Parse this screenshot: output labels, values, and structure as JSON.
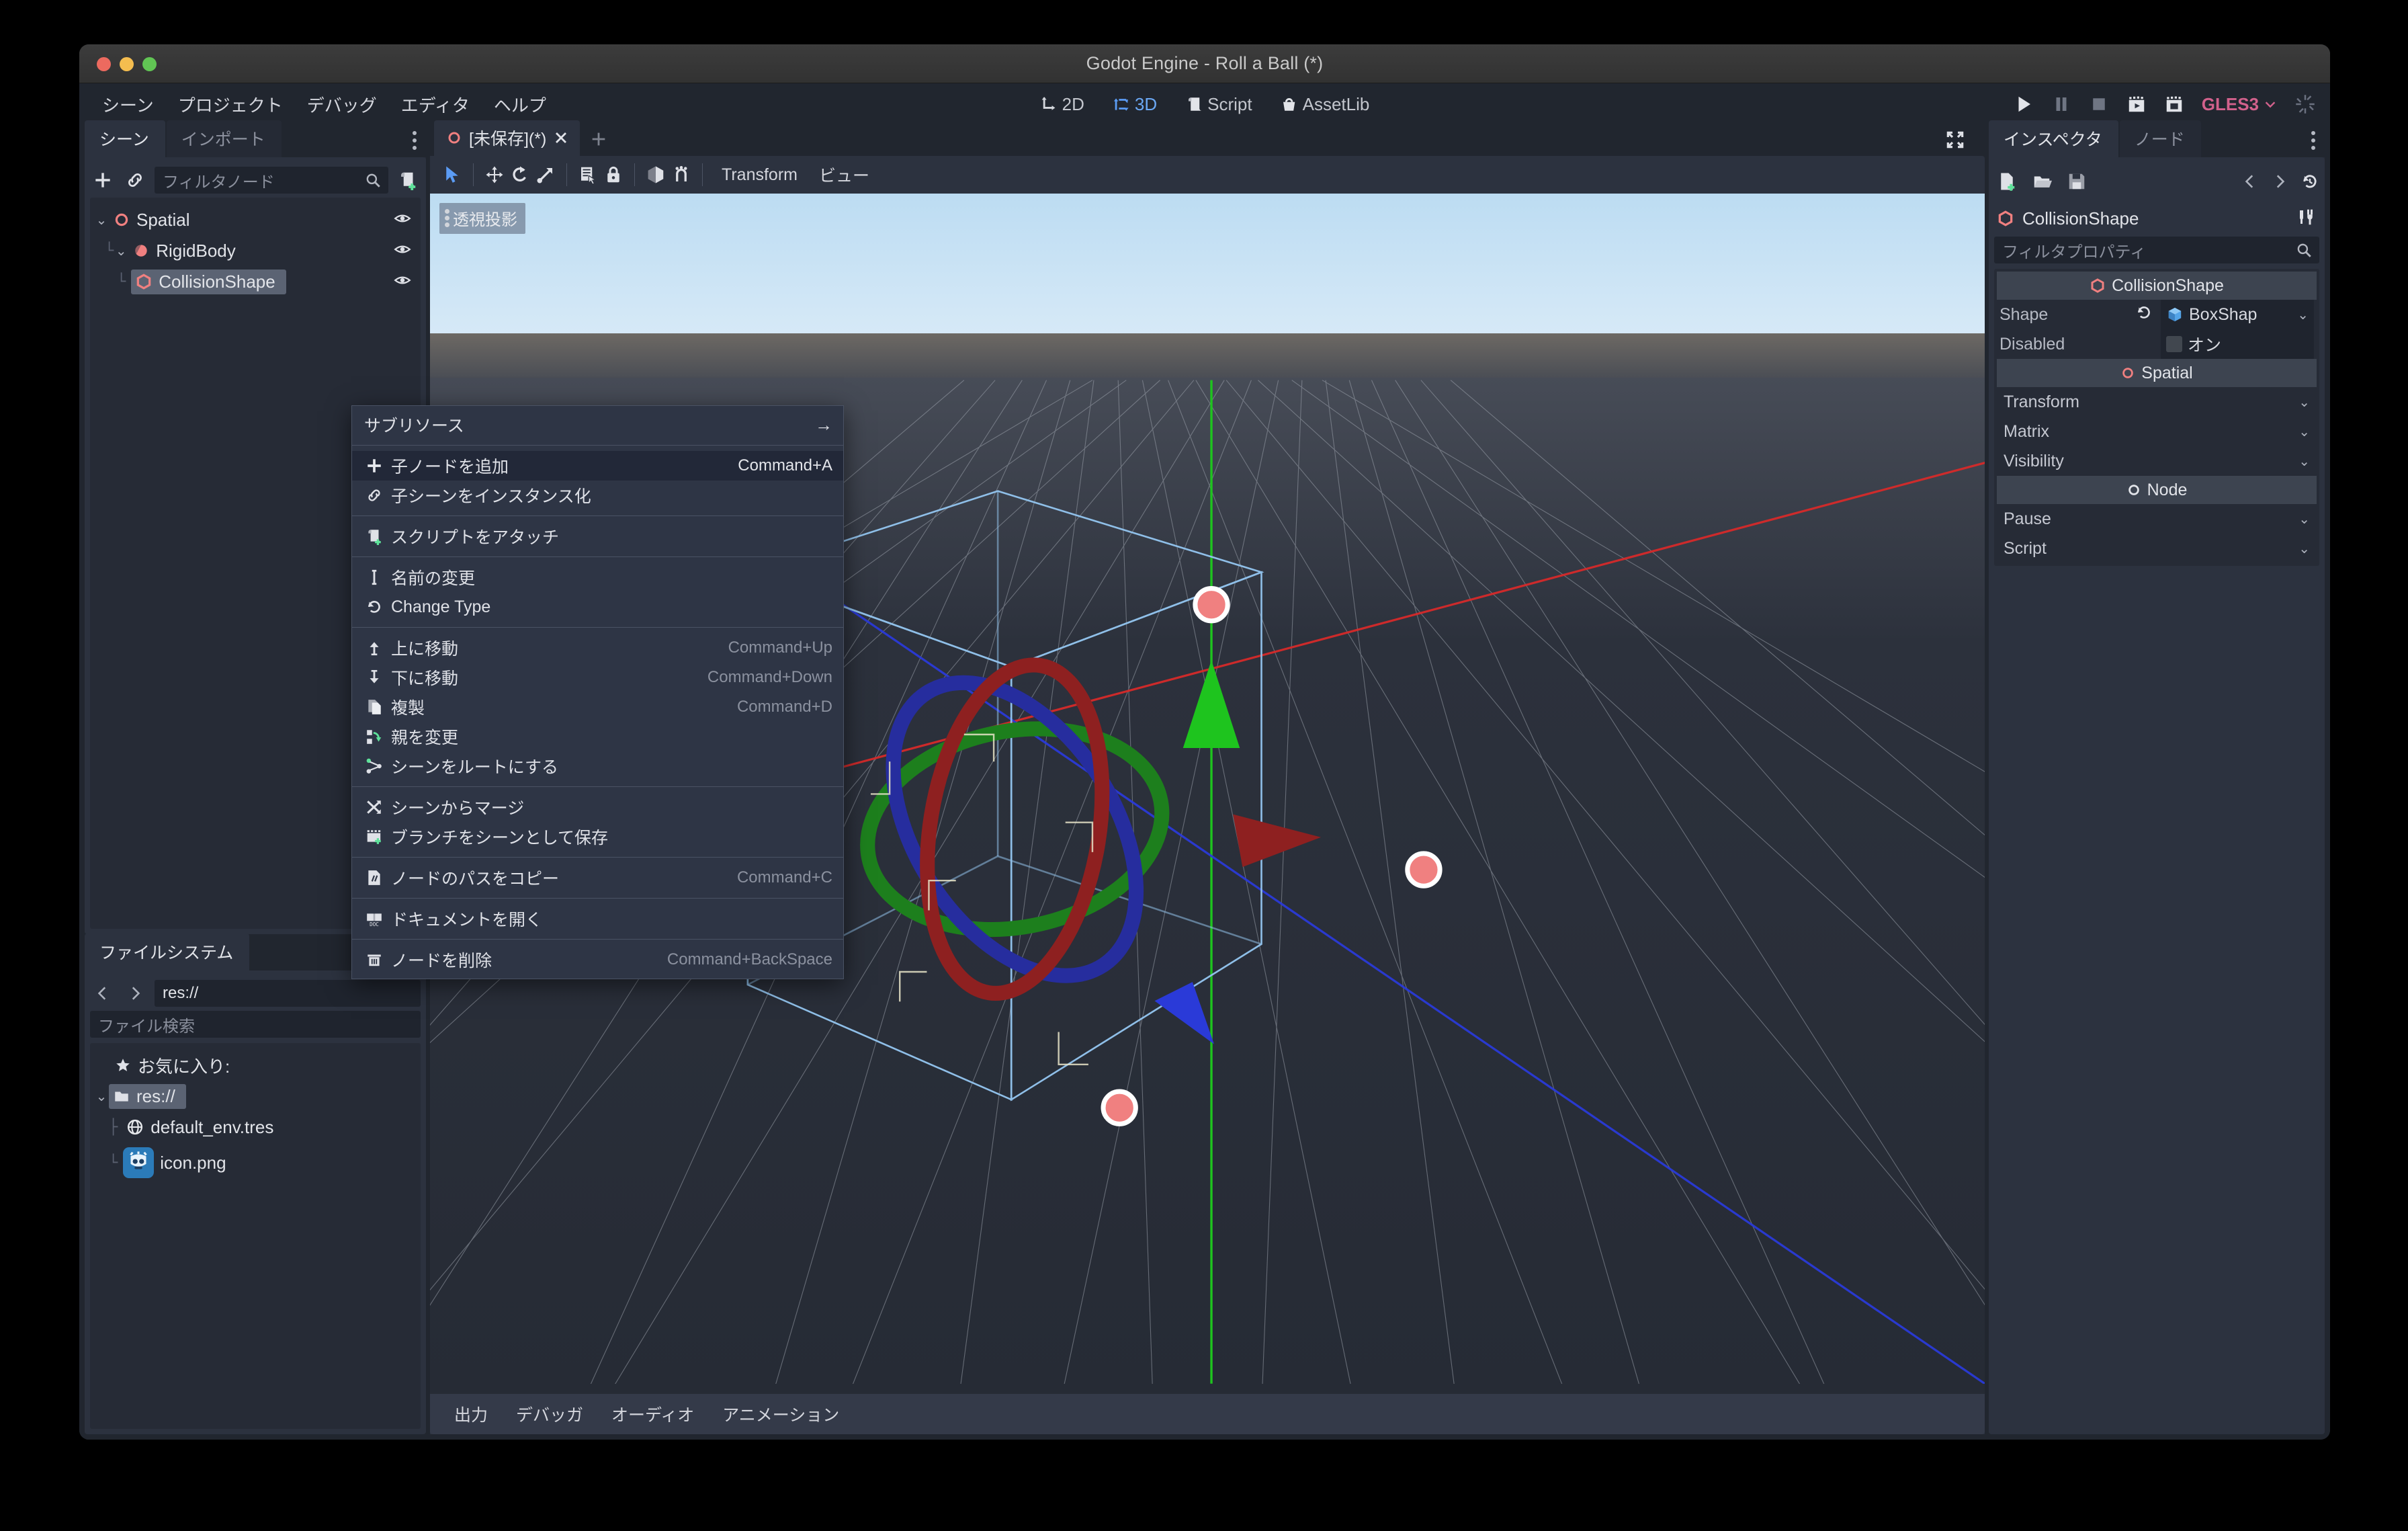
{
  "window": {
    "title": "Godot Engine - Roll a Ball (*)"
  },
  "menubar": {
    "items": [
      "シーン",
      "プロジェクト",
      "デバッグ",
      "エディタ",
      "ヘルプ"
    ]
  },
  "center_tools": {
    "modes": [
      {
        "label": "2D",
        "icon": "2d-icon",
        "active": false
      },
      {
        "label": "3D",
        "icon": "3d-icon",
        "active": true
      },
      {
        "label": "Script",
        "icon": "script-icon",
        "active": false
      },
      {
        "label": "AssetLib",
        "icon": "assetlib-icon",
        "active": false
      }
    ]
  },
  "right_tools": {
    "play": "play-icon",
    "pause": "pause-icon",
    "stop": "stop-icon",
    "play_scene": "play-scene-icon",
    "play_custom": "play-custom-scene-icon",
    "renderer": "GLES3",
    "busy": "progress-spinner-icon"
  },
  "scene_dock": {
    "tabs": [
      {
        "label": "シーン",
        "active": true
      },
      {
        "label": "インポート",
        "active": false
      }
    ],
    "toolbar": {
      "add_node": "plus-icon",
      "instance_scene": "link-icon",
      "filter_placeholder": "フィルタノード",
      "search_icon": "search-icon",
      "attach_script": "attach-script-icon"
    },
    "tree": [
      {
        "label": "Spatial",
        "icon": "spatial-node-icon",
        "depth": 0,
        "selected": false,
        "visible_icon": "eye-icon"
      },
      {
        "label": "RigidBody",
        "icon": "rigidbody-node-icon",
        "depth": 1,
        "selected": false,
        "visible_icon": "eye-icon"
      },
      {
        "label": "CollisionShape",
        "icon": "collisionshape-node-icon",
        "depth": 2,
        "selected": true,
        "visible_icon": "eye-icon"
      }
    ]
  },
  "filesystem_dock": {
    "tabs": [
      {
        "label": "ファイルシステム",
        "active": true
      }
    ],
    "path_value": "res://",
    "back_icon": "chevron-left-icon",
    "forward_icon": "chevron-right-icon",
    "search_placeholder": "ファイル検索",
    "tree": [
      {
        "label": "お気に入り:",
        "icon": "star-icon",
        "depth": 0,
        "selected": false
      },
      {
        "label": "res://",
        "icon": "folder-icon",
        "depth": 0,
        "selected": true
      },
      {
        "label": "default_env.tres",
        "icon": "world-environment-icon",
        "depth": 1,
        "selected": false
      },
      {
        "label": "icon.png",
        "icon": "godot-icon",
        "depth": 1,
        "selected": false
      }
    ]
  },
  "scene_tabs": {
    "tabs": [
      {
        "label": "[未保存](*)",
        "icon": "spatial-node-icon",
        "close_icon": "close-icon",
        "active": true
      }
    ],
    "new_tab_icon": "plus-icon",
    "expand_icon": "expand-icon"
  },
  "viewport_toolbar": {
    "tools": [
      {
        "name": "select-mode-icon",
        "active": true
      },
      {
        "name": "move-mode-icon",
        "active": false
      },
      {
        "name": "rotate-mode-icon",
        "active": false
      },
      {
        "name": "scale-mode-icon",
        "active": false
      },
      {
        "name": "list-select-icon",
        "active": false
      },
      {
        "name": "lock-icon",
        "active": false
      },
      {
        "name": "local-space-icon",
        "active": false
      },
      {
        "name": "snap-icon",
        "active": false
      }
    ],
    "menus": [
      "Transform",
      "ビュー"
    ]
  },
  "viewport": {
    "projection_label": "透視投影",
    "projection_menu_icon": "dots-vertical-icon",
    "sky_color": "#c7e2f4",
    "ground_color": "#2c313c",
    "gizmo": {
      "x_axis_color": "#e0282c",
      "y_axis_color": "#22c422",
      "z_axis_color": "#2230dd",
      "handle_color": "#f08080",
      "box_wire_color": "#8fbfe8"
    }
  },
  "bottom_panel": {
    "tabs": [
      "出力",
      "デバッガ",
      "オーディオ",
      "アニメーション"
    ]
  },
  "inspector": {
    "tabs": [
      {
        "label": "インスペクタ",
        "active": true
      },
      {
        "label": "ノード",
        "active": false
      }
    ],
    "toolbar": {
      "new_resource": "new-resource-icon",
      "load": "folder-open-icon",
      "save": "save-icon",
      "back": "chevron-left-icon",
      "forward": "chevron-right-icon",
      "history": "history-icon"
    },
    "object_name": "CollisionShape",
    "object_icon": "collisionshape-node-icon",
    "tools_icon": "object-tools-icon",
    "filter_placeholder": "フィルタプロパティ",
    "filter_search_icon": "search-icon",
    "sections": [
      {
        "type": "category",
        "label": "CollisionShape",
        "icon": "collisionshape-node-icon"
      },
      {
        "type": "property",
        "label": "Shape",
        "revert_icon": "revert-icon",
        "value": "BoxShap",
        "value_icon": "boxshape-icon",
        "caret": "chevron-down-icon"
      },
      {
        "type": "property_check",
        "label": "Disabled",
        "value": "オン",
        "checked": false
      },
      {
        "type": "category",
        "label": "Spatial",
        "icon": "spatial-node-icon"
      },
      {
        "type": "fold",
        "label": "Transform",
        "caret": "chevron-down-icon"
      },
      {
        "type": "fold",
        "label": "Matrix",
        "caret": "chevron-down-icon"
      },
      {
        "type": "fold",
        "label": "Visibility",
        "caret": "chevron-down-icon"
      },
      {
        "type": "category",
        "label": "Node",
        "icon": "node-icon"
      },
      {
        "type": "fold",
        "label": "Pause",
        "caret": "chevron-down-icon"
      },
      {
        "type": "fold",
        "label": "Script",
        "caret": "chevron-down-icon"
      }
    ]
  },
  "context_menu": {
    "items": [
      {
        "kind": "submenu",
        "label": "サブリソース",
        "arrow": "arrow-right-icon"
      },
      {
        "kind": "separator"
      },
      {
        "kind": "item",
        "label": "子ノードを追加",
        "accel": "Command+A",
        "icon": "plus-icon",
        "highlighted": true
      },
      {
        "kind": "item",
        "label": "子シーンをインスタンス化",
        "accel": "",
        "icon": "link-icon"
      },
      {
        "kind": "separator"
      },
      {
        "kind": "item",
        "label": "スクリプトをアタッチ",
        "accel": "",
        "icon": "attach-script-icon"
      },
      {
        "kind": "separator"
      },
      {
        "kind": "item",
        "label": "名前の変更",
        "accel": "",
        "icon": "rename-icon"
      },
      {
        "kind": "item",
        "label": "Change Type",
        "accel": "",
        "icon": "reload-icon"
      },
      {
        "kind": "separator"
      },
      {
        "kind": "item",
        "label": "上に移動",
        "accel": "Command+Up",
        "icon": "move-up-icon"
      },
      {
        "kind": "item",
        "label": "下に移動",
        "accel": "Command+Down",
        "icon": "move-down-icon"
      },
      {
        "kind": "item",
        "label": "複製",
        "accel": "Command+D",
        "icon": "duplicate-icon"
      },
      {
        "kind": "item",
        "label": "親を変更",
        "accel": "",
        "icon": "reparent-icon"
      },
      {
        "kind": "item",
        "label": "シーンをルートにする",
        "accel": "",
        "icon": "make-root-icon"
      },
      {
        "kind": "separator"
      },
      {
        "kind": "item",
        "label": "シーンからマージ",
        "accel": "",
        "icon": "merge-icon"
      },
      {
        "kind": "item",
        "label": "ブランチをシーンとして保存",
        "accel": "",
        "icon": "save-branch-icon"
      },
      {
        "kind": "separator"
      },
      {
        "kind": "item",
        "label": "ノードのパスをコピー",
        "accel": "Command+C",
        "icon": "copy-path-icon"
      },
      {
        "kind": "separator"
      },
      {
        "kind": "item",
        "label": "ドキュメントを開く",
        "accel": "",
        "icon": "documentation-icon"
      },
      {
        "kind": "separator"
      },
      {
        "kind": "item",
        "label": "ノードを削除",
        "accel": "Command+BackSpace",
        "icon": "trash-icon"
      }
    ]
  }
}
